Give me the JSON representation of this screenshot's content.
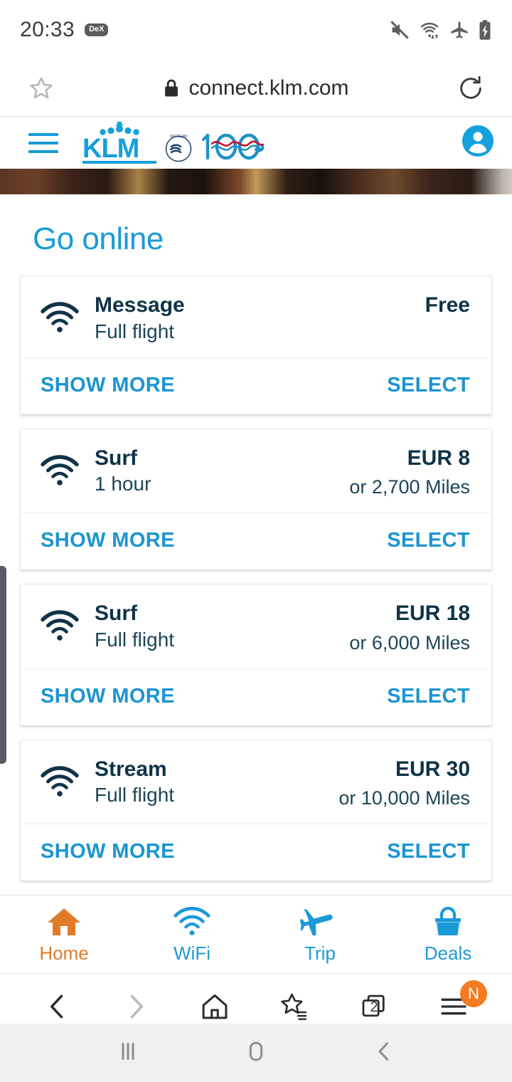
{
  "status_bar": {
    "time": "20:33",
    "dex_label": "DeX",
    "icons": [
      "mute-icon",
      "wifi-icon",
      "airplane-mode-icon",
      "battery-charging-icon"
    ]
  },
  "browser": {
    "url": "connect.klm.com",
    "lock_icon": "lock-icon",
    "bookmark_icon": "star-icon",
    "reload_icon": "reload-icon",
    "toolbar": {
      "back": "back-icon",
      "forward": "forward-icon",
      "home": "home-icon",
      "bookmarks": "bookmarks-star-icon",
      "tabs_count": "2",
      "menu": "menu-icon",
      "menu_badge": "N"
    }
  },
  "site_header": {
    "menu_icon": "hamburger-icon",
    "brand": "KLM",
    "anniversary": "100",
    "skyteam": "SKYTEAM",
    "account_icon": "account-icon"
  },
  "main": {
    "title": "Go online",
    "offers": [
      {
        "icon": "wifi-icon",
        "name": "Message",
        "duration": "Full flight",
        "price": "Free",
        "miles": "",
        "show_more": "SHOW MORE",
        "select": "SELECT"
      },
      {
        "icon": "wifi-icon",
        "name": "Surf",
        "duration": "1 hour",
        "price": "EUR 8",
        "miles": "or 2,700 Miles",
        "show_more": "SHOW MORE",
        "select": "SELECT"
      },
      {
        "icon": "wifi-icon",
        "name": "Surf",
        "duration": "Full flight",
        "price": "EUR 18",
        "miles": "or 6,000 Miles",
        "show_more": "SHOW MORE",
        "select": "SELECT"
      },
      {
        "icon": "wifi-icon",
        "name": "Stream",
        "duration": "Full flight",
        "price": "EUR 30",
        "miles": "or 10,000 Miles",
        "show_more": "SHOW MORE",
        "select": "SELECT"
      }
    ]
  },
  "app_nav": [
    {
      "label": "Home",
      "icon": "house-icon",
      "color": "#e07b2a",
      "active": true
    },
    {
      "label": "WiFi",
      "icon": "wifi-icon",
      "color": "#1b9ad6",
      "active": false
    },
    {
      "label": "Trip",
      "icon": "airplane-icon",
      "color": "#1b9ad6",
      "active": false
    },
    {
      "label": "Deals",
      "icon": "bag-icon",
      "color": "#1b9ad6",
      "active": false
    }
  ],
  "system_nav": {
    "recents": "recents-icon",
    "home": "home-circle-icon",
    "back": "back-chevron-icon"
  },
  "colors": {
    "klm_blue": "#1b95d1",
    "klm_light_blue": "#179bd7",
    "dark_navy": "#0f3347",
    "accent_orange": "#e07b2a",
    "badge_orange": "#f47b20"
  }
}
